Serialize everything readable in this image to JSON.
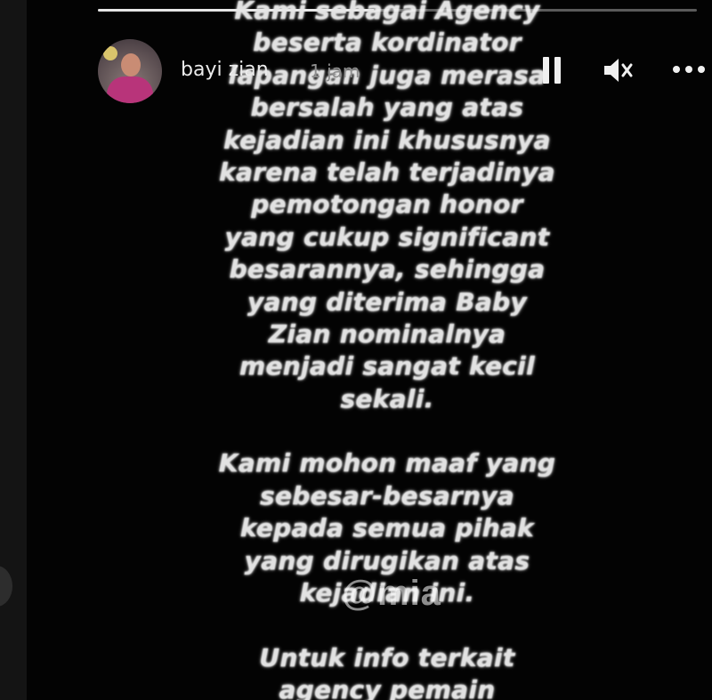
{
  "story": {
    "progress_fraction": 0.46,
    "user": {
      "name": "bayi zian",
      "time_ago": "1 jam"
    },
    "controls": {
      "pause_icon": "pause-icon",
      "mute_icon": "speaker-muted-icon",
      "more_icon": "more-horizontal-icon"
    },
    "text_lines": [
      "Kami sebagai Agency",
      "beserta kordinator",
      "lapangan juga merasa",
      "bersalah yang atas",
      "kejadian ini khususnya",
      "karena telah terjadinya",
      "pemotongan honor",
      "yang cukup significant",
      "besarannya, sehingga",
      "yang diterima Baby",
      "Zian nominalnya",
      "menjadi sangat kecil",
      "sekali.",
      "",
      "Kami mohon maaf yang",
      "sebesar-besarnya",
      "kepada semua pihak",
      "yang dirugikan atas",
      "kejadian ini.",
      "",
      "Untuk info terkait",
      "agency pemain"
    ],
    "watermark": "@mia"
  },
  "colors": {
    "background": "#000000",
    "panel": "#030303",
    "text": "#e2e2e2",
    "muted_text": "#8e8e8e"
  }
}
